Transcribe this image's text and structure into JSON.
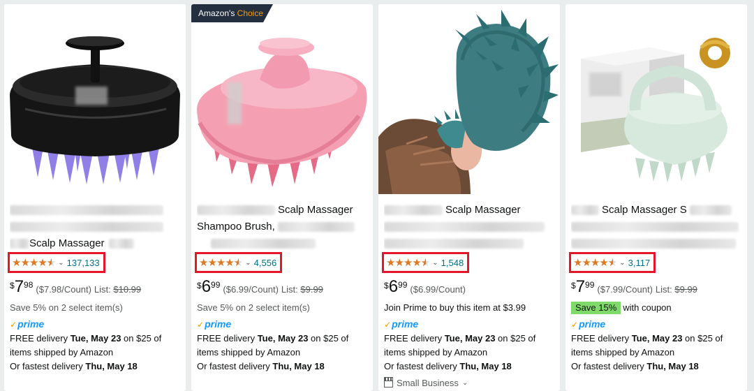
{
  "products": [
    {
      "badge": null,
      "title_lines": [
        "",
        "",
        "Scalp Massager"
      ],
      "rating": 4.5,
      "review_count": "137,133",
      "price_symbol": "$",
      "price_whole": "7",
      "price_fraction": "98",
      "unit_price": "($7.98/Count)",
      "list_label": "List:",
      "list_price": "$10.99",
      "promo_badge": null,
      "promo_text": "Save 5% on 2 select item(s)",
      "prime": "prime",
      "delivery_prefix": "FREE delivery ",
      "delivery_date": "Tue, May 23",
      "delivery_suffix": " on $25 of",
      "delivery_line2": "items shipped by Amazon",
      "fastest_prefix": "Or fastest delivery ",
      "fastest_date": "Thu, May 18",
      "small_business": null
    },
    {
      "badge": {
        "prefix": "Amazon's ",
        "highlight": "Choice"
      },
      "title_lines": [
        "Scalp Massager",
        "Shampoo Brush,",
        ""
      ],
      "rating": 4.5,
      "review_count": "4,556",
      "price_symbol": "$",
      "price_whole": "6",
      "price_fraction": "99",
      "unit_price": "($6.99/Count)",
      "list_label": "List:",
      "list_price": "$9.99",
      "promo_badge": null,
      "promo_text": "Save 5% on 2 select item(s)",
      "prime": "prime",
      "delivery_prefix": "FREE delivery ",
      "delivery_date": "Tue, May 23",
      "delivery_suffix": " on $25 of",
      "delivery_line2": "items shipped by Amazon",
      "fastest_prefix": "Or fastest delivery ",
      "fastest_date": "Thu, May 18",
      "small_business": null
    },
    {
      "badge": null,
      "title_lines": [
        "Scalp Massager",
        "",
        ""
      ],
      "rating": 4.5,
      "review_count": "1,548",
      "price_symbol": "$",
      "price_whole": "6",
      "price_fraction": "99",
      "unit_price": "($6.99/Count)",
      "list_label": "",
      "list_price": "",
      "promo_badge": null,
      "promo_text": "Join Prime to buy this item at $3.99",
      "prime": "prime",
      "delivery_prefix": "FREE delivery ",
      "delivery_date": "Tue, May 23",
      "delivery_suffix": " on $25 of",
      "delivery_line2": "items shipped by Amazon",
      "fastest_prefix": "Or fastest delivery ",
      "fastest_date": "Thu, May 18",
      "small_business": "Small Business"
    },
    {
      "badge": null,
      "title_lines": [
        "Scalp Massager S",
        "",
        ""
      ],
      "rating": 4.5,
      "review_count": "3,117",
      "price_symbol": "$",
      "price_whole": "7",
      "price_fraction": "99",
      "unit_price": "($7.99/Count)",
      "list_label": "List:",
      "list_price": "$9.99",
      "promo_badge": "Save 15%",
      "promo_text": "with coupon",
      "prime": "prime",
      "delivery_prefix": "FREE delivery ",
      "delivery_date": "Tue, May 23",
      "delivery_suffix": " on $25 of",
      "delivery_line2": "items shipped by Amazon",
      "fastest_prefix": "Or fastest delivery ",
      "fastest_date": "Thu, May 18",
      "small_business": null
    }
  ],
  "colors": {
    "star": "#de7921",
    "link": "#007185",
    "highlight_border": "#e5162a",
    "prime_blue": "#1399ff",
    "save_green": "#7fda69",
    "badge_bg": "#232f3e",
    "badge_orange": "#ff9900"
  }
}
